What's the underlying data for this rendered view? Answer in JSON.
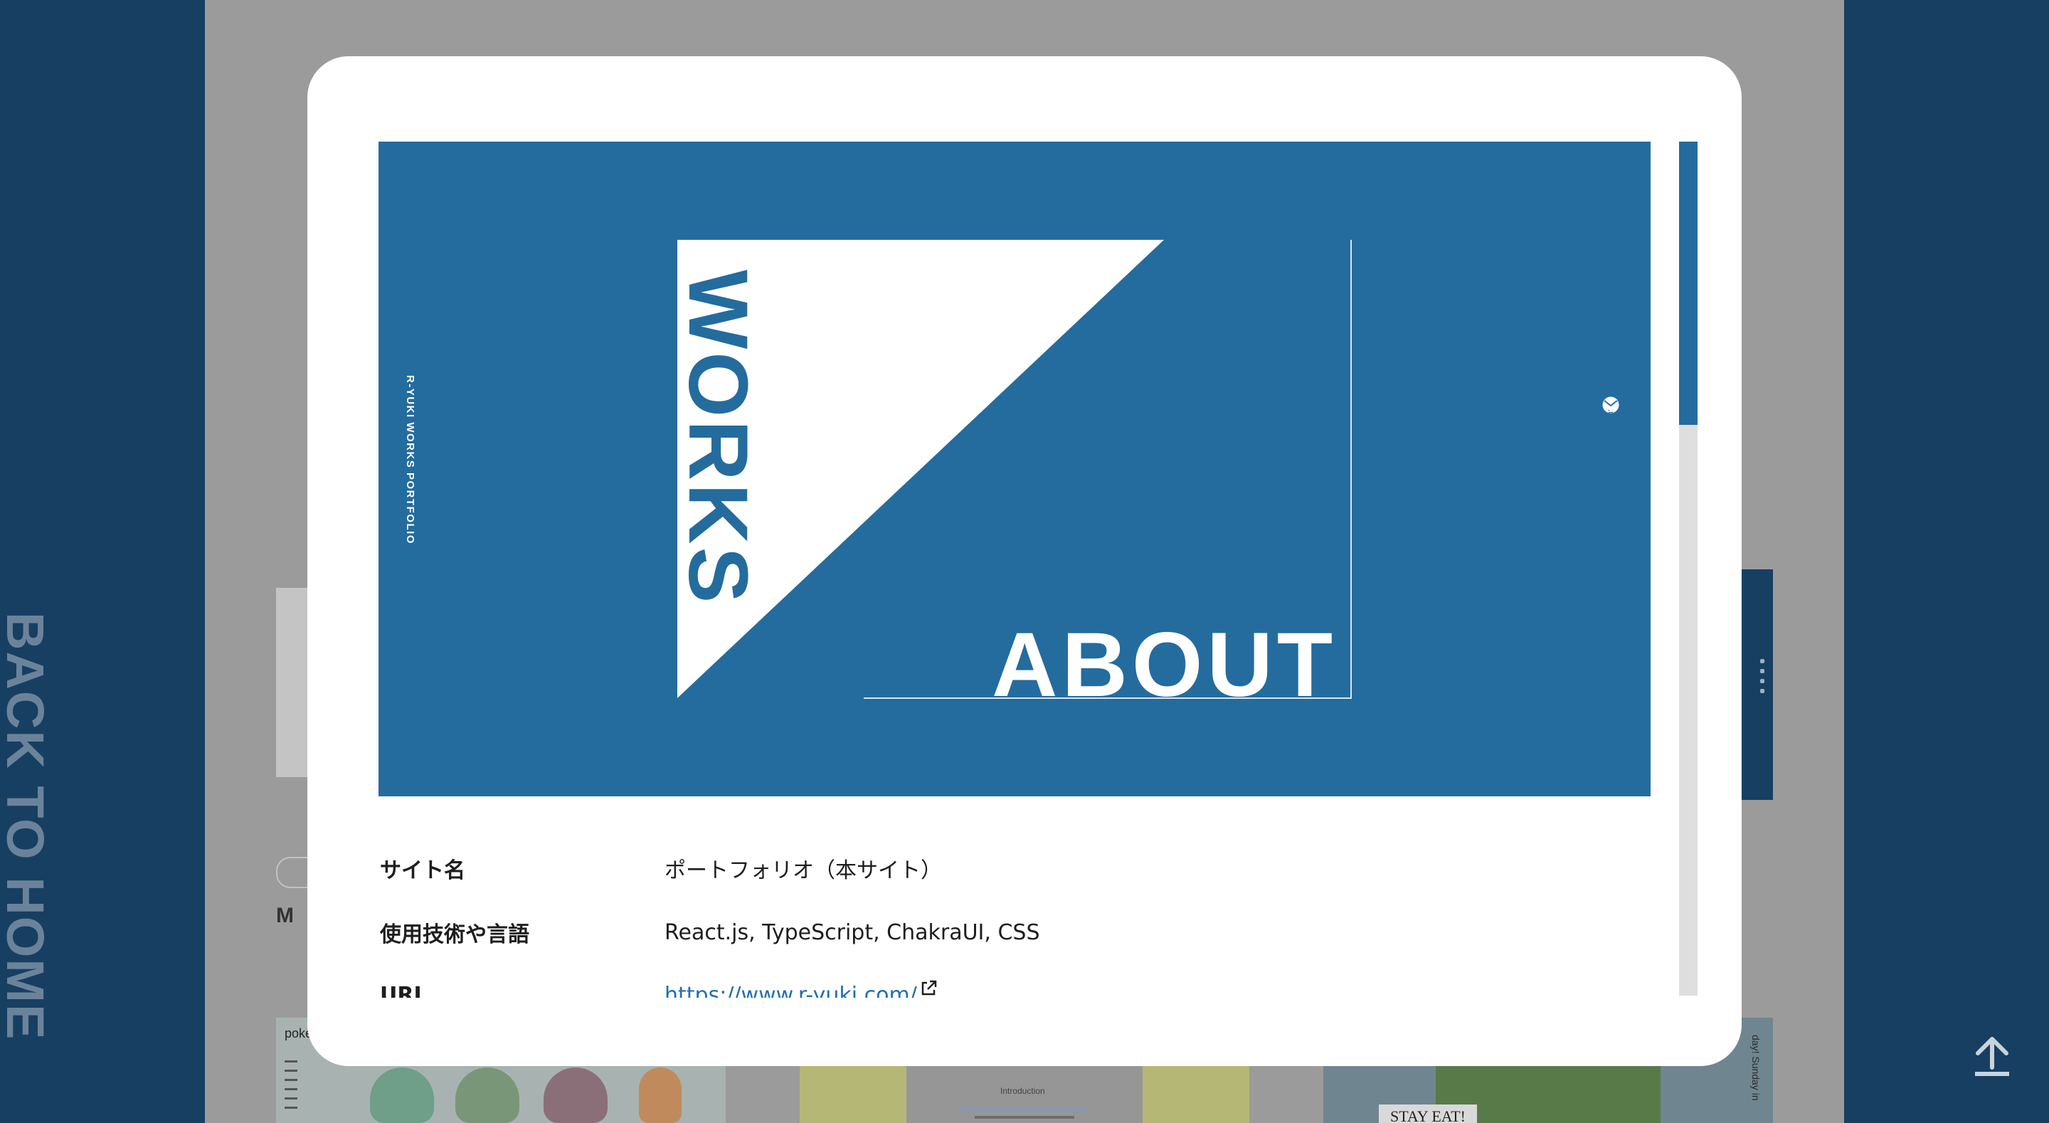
{
  "sidebar_left": {
    "back_to_home": "BACK TO HOME"
  },
  "background_page": {
    "m_label": "M",
    "thumb1_label": "poke",
    "thumb2_title": "Introduction",
    "thumb3_sign": "STAY EAT!"
  },
  "modal": {
    "preview": {
      "vertical_title": "R-YUKI WORKS PORTFOLIO",
      "works": "WORKS",
      "about": "ABOUT",
      "social_icons": [
        "twitter-icon",
        "github-icon",
        "pinterest-icon",
        "mail-icon"
      ]
    },
    "details": [
      {
        "label": "サイト名",
        "value": "ポートフォリオ（本サイト）"
      },
      {
        "label": "使用技術や言語",
        "value": "React.js, TypeScript, ChakraUI, CSS"
      },
      {
        "label": "URL",
        "value": "https://www.r-yuki.com/"
      }
    ]
  },
  "colors": {
    "sidebar_navy": "#173f62",
    "preview_blue": "#246c9e",
    "overlay_gray": "#9b9b9b",
    "link_blue": "#1f6fb2"
  }
}
